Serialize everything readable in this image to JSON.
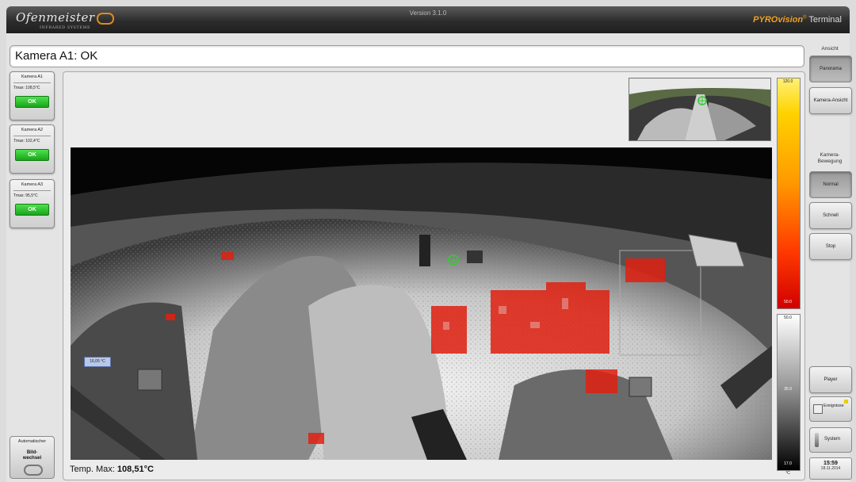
{
  "app": {
    "logo_text": "Ofenmeister",
    "logo_sub": "INFRARED SYSTEME",
    "window_title": "Version 3.1.0",
    "brand_name": "PYROvision",
    "brand_suffix": "Terminal"
  },
  "status": {
    "text": "Kamera A1: OK"
  },
  "cameras": [
    {
      "name": "Kamera A1",
      "max": "Tmax: 108,5°C",
      "state": "OK"
    },
    {
      "name": "Kamera A2",
      "max": "Tmax: 102,4°C",
      "state": "OK"
    },
    {
      "name": "Kamera A3",
      "max": "Tmax: 95,5°C",
      "state": "OK"
    }
  ],
  "auto_switch": {
    "line1": "Automatischer",
    "line2": "Bild-",
    "line3": "wechsel"
  },
  "right_panel": {
    "ansicht_label": "Ansicht",
    "panorama_label": "Panorama",
    "kamera_ansicht_label": "Kamera-Ansicht",
    "bewegung_label": "Kamera-Bewegung",
    "normal_label": "Normal",
    "schnell_label": "Schnell",
    "stop_label": "Stop",
    "player_label": "Player",
    "ereignisse_label": "Ereignisse",
    "system_label": "System"
  },
  "clock": {
    "time": "15:59",
    "date": "18.11.2014"
  },
  "scale": {
    "max": "120.0",
    "mid_hot": "50.0",
    "mid_cold": "50.0",
    "mid": "35.0",
    "min": "17.0",
    "unit": "°C"
  },
  "marker": {
    "label": "16,05 °C"
  },
  "temp": {
    "label": "Temp. Max:",
    "value": "108,51°C"
  },
  "colors": {
    "ok_green": "#1aa51a",
    "hotspot_red": "#e02010",
    "brand_orange": "#f0a020"
  }
}
